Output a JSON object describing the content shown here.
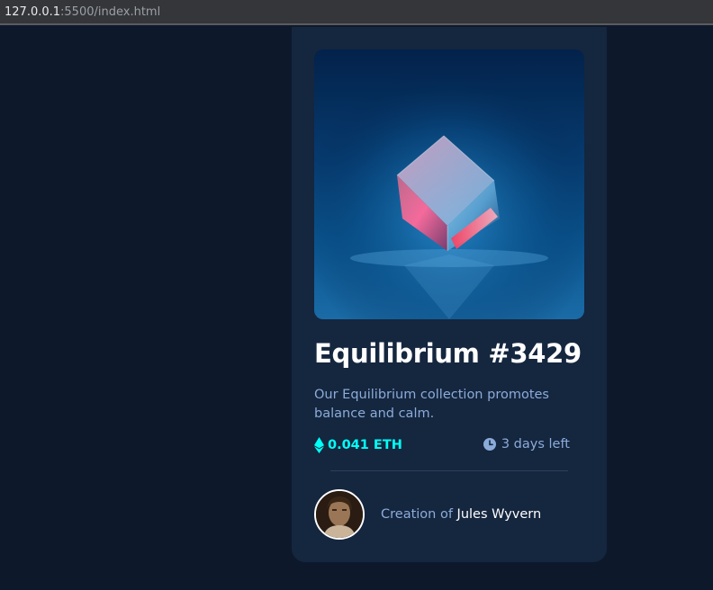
{
  "browser": {
    "url_host": "127.0.0.1",
    "url_path": ":5500/index.html"
  },
  "card": {
    "image_alt": "Equilibrium",
    "title": "Equilibrium #3429",
    "description": "Our Equilibrium collection promotes balance and calm.",
    "price": "0.041 ETH",
    "time_left": "3 days left",
    "creator_prefix": "Creation of ",
    "creator_name": "Jules Wyvern"
  },
  "colors": {
    "background": "#0d192b",
    "card": "#15263f",
    "accent_cyan": "#00fff8",
    "soft_blue": "#8bacd9",
    "white": "#ffffff"
  },
  "icons": {
    "price": "ethereum-icon",
    "time": "clock-icon"
  }
}
